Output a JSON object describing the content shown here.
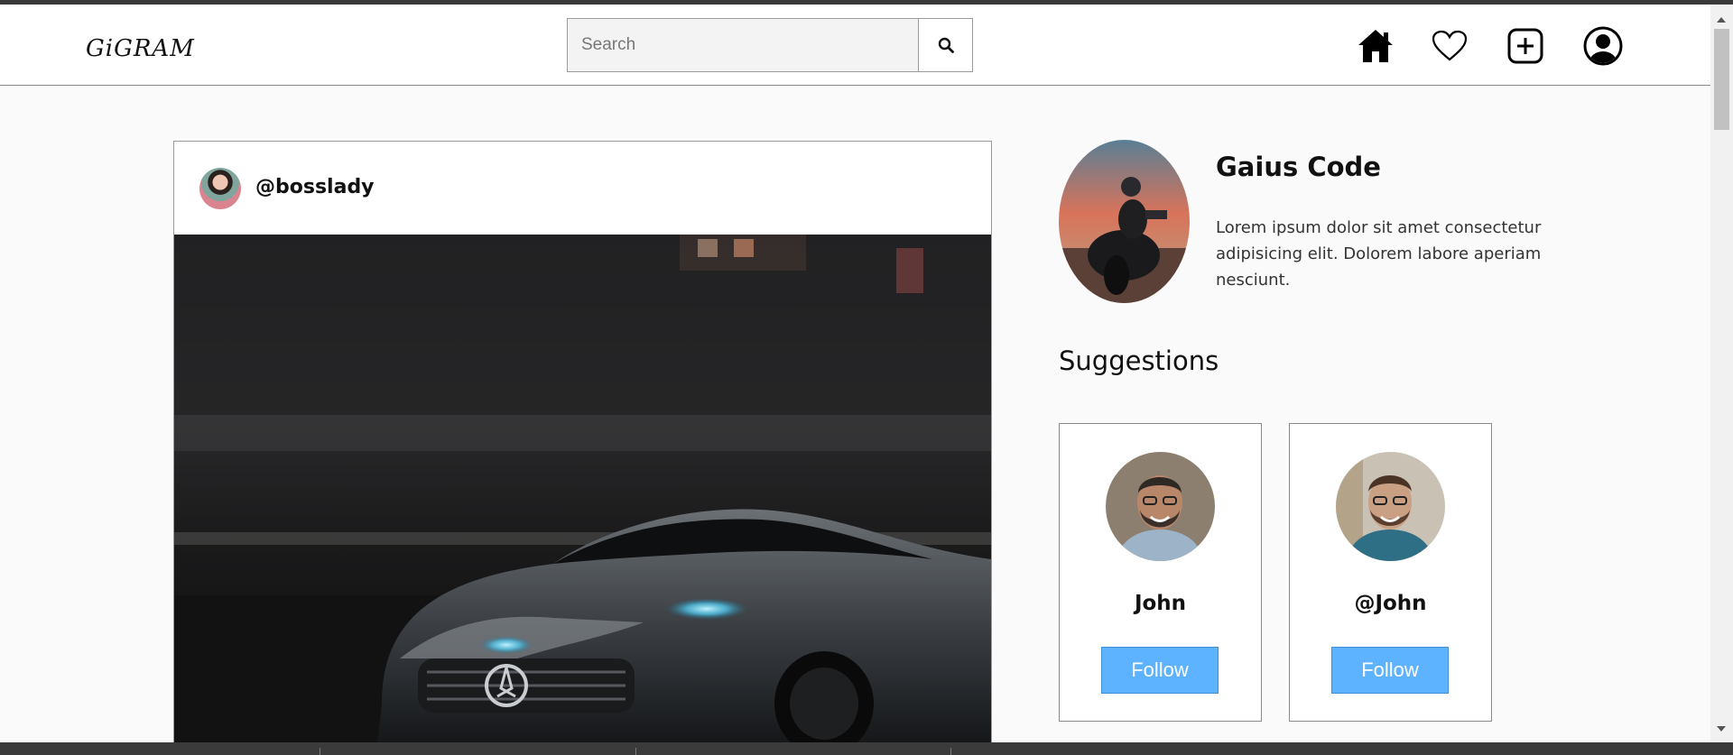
{
  "navbar": {
    "logo": "GiGRAM",
    "search": {
      "placeholder": "Search",
      "value": ""
    },
    "icons": [
      "home-icon",
      "heart-icon",
      "plus-square-icon",
      "user-circle-icon"
    ]
  },
  "post": {
    "username": "@bosslady"
  },
  "profile": {
    "name": "Gaius Code",
    "bio": "Lorem ipsum dolor sit amet consectetur adipisicing elit. Dolorem labore aperiam nesciunt."
  },
  "suggestions": {
    "title": "Suggestions",
    "items": [
      {
        "name": "John",
        "follow_label": "Follow"
      },
      {
        "name": "@John",
        "follow_label": "Follow"
      }
    ]
  },
  "colors": {
    "follow_button": "#5db3ff",
    "navbar_bg": "#ffffff",
    "page_bg": "#fafafa"
  }
}
